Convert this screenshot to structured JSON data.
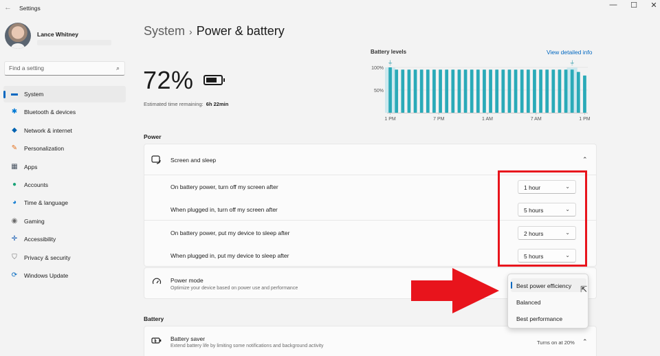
{
  "window": {
    "title": "Settings",
    "back_icon": "back-arrow-icon",
    "minimize": "—",
    "maximize": "☐",
    "close": "✕"
  },
  "account": {
    "name": "Lance Whitney"
  },
  "search": {
    "placeholder": "Find a setting"
  },
  "sidebar": {
    "items": [
      {
        "label": "System",
        "icon": "monitor-icon",
        "color": "#0067c0",
        "active": true
      },
      {
        "label": "Bluetooth & devices",
        "icon": "bluetooth-icon",
        "color": "#0078d4"
      },
      {
        "label": "Network & internet",
        "icon": "wifi-icon",
        "color": "#0063b1"
      },
      {
        "label": "Personalization",
        "icon": "brush-icon",
        "color": "#e3701b"
      },
      {
        "label": "Apps",
        "icon": "apps-icon",
        "color": "#4a5563"
      },
      {
        "label": "Accounts",
        "icon": "person-icon",
        "color": "#1aa378"
      },
      {
        "label": "Time & language",
        "icon": "globe-clock-icon",
        "color": "#0f7bd1"
      },
      {
        "label": "Gaming",
        "icon": "gamepad-icon",
        "color": "#6a6a6a"
      },
      {
        "label": "Accessibility",
        "icon": "accessibility-icon",
        "color": "#1a5fb4"
      },
      {
        "label": "Privacy & security",
        "icon": "shield-icon",
        "color": "#6b6b6b"
      },
      {
        "label": "Windows Update",
        "icon": "update-icon",
        "color": "#0067c0"
      }
    ]
  },
  "breadcrumb": {
    "parent": "System",
    "separator": "›",
    "current": "Power & battery"
  },
  "battery": {
    "percent": "72%",
    "estimate_label": "Estimated time remaining:",
    "estimate_value": "6h 22min"
  },
  "levels": {
    "title": "Battery levels",
    "link": "View detailed info"
  },
  "chart_data": {
    "type": "bar",
    "title": "Battery levels",
    "y_ticks": [
      "100%",
      "50%"
    ],
    "x_ticks": [
      "1 PM",
      "7 PM",
      "1 AM",
      "7 AM",
      "1 PM"
    ],
    "ylim": [
      0,
      100
    ],
    "values": [
      100,
      95,
      95,
      95,
      95,
      95,
      95,
      95,
      95,
      95,
      95,
      95,
      95,
      95,
      95,
      95,
      95,
      95,
      95,
      95,
      95,
      95,
      95,
      95,
      95,
      95,
      95,
      95,
      95,
      95,
      90,
      82
    ],
    "plug_markers": [
      0,
      29
    ],
    "bar_color": "#2aaab8",
    "plug_band_color": "#cce8ee"
  },
  "power": {
    "header": "Power",
    "screen_sleep": {
      "label": "Screen and sleep",
      "icon": "screen-sleep-icon",
      "rows": [
        {
          "label": "On battery power, turn off my screen after",
          "value": "1 hour"
        },
        {
          "label": "When plugged in, turn off my screen after",
          "value": "5 hours"
        },
        {
          "label": "On battery power, put my device to sleep after",
          "value": "2 hours"
        },
        {
          "label": "When plugged in, put my device to sleep after",
          "value": "5 hours"
        }
      ]
    },
    "power_mode": {
      "label": "Power mode",
      "description": "Optimize your device based on power use and performance",
      "icon": "speedometer-icon",
      "options": [
        "Best power efficiency",
        "Balanced",
        "Best performance"
      ],
      "selected": "Best power efficiency"
    }
  },
  "battery_section": {
    "header": "Battery",
    "saver": {
      "label": "Battery saver",
      "description": "Extend battery life by limiting some notifications and background activity",
      "status": "Turns on at 20%",
      "icon": "battery-saver-icon"
    }
  },
  "annotation": {
    "box_color": "#e8141c",
    "arrow_color": "#e8141c"
  }
}
